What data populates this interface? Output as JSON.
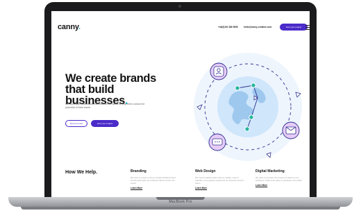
{
  "nav": {
    "logo": "canny",
    "logo_dot": ".",
    "phone": "+44(0)191 386 5050",
    "email": "hello@canny-creative.com",
    "cta_label": "start your project"
  },
  "hero": {
    "title": "We create brands that build businesses",
    "title_dot": ".",
    "subtitle": "We work with businesses from around the world to help them unlock the potential of their brand.",
    "btn_outline": "Find out more",
    "btn_filled": "start your project"
  },
  "services": {
    "heading": "How We Help.",
    "items": [
      {
        "title": "Branding",
        "desc": "We want to create a strong, forward-thinking brand identity that helps our business stand out from the crowd.",
        "link": "Learn More"
      },
      {
        "title": "Web Design",
        "desc": "We need a website that's easy to update, easy to maintain, and properly represents our business and it's vision.",
        "link": "Learn More"
      },
      {
        "title": "Digital Marketing",
        "desc": "We want to increase the amount of visitors to our website to make more sales or generate more leads.",
        "link": "Learn More"
      }
    ]
  },
  "device": {
    "model": "MacBook Pro"
  },
  "colors": {
    "accent": "#4b2bc9",
    "brand_dot": "#2ab6d2",
    "globe_ring": "#e8f2fc"
  }
}
